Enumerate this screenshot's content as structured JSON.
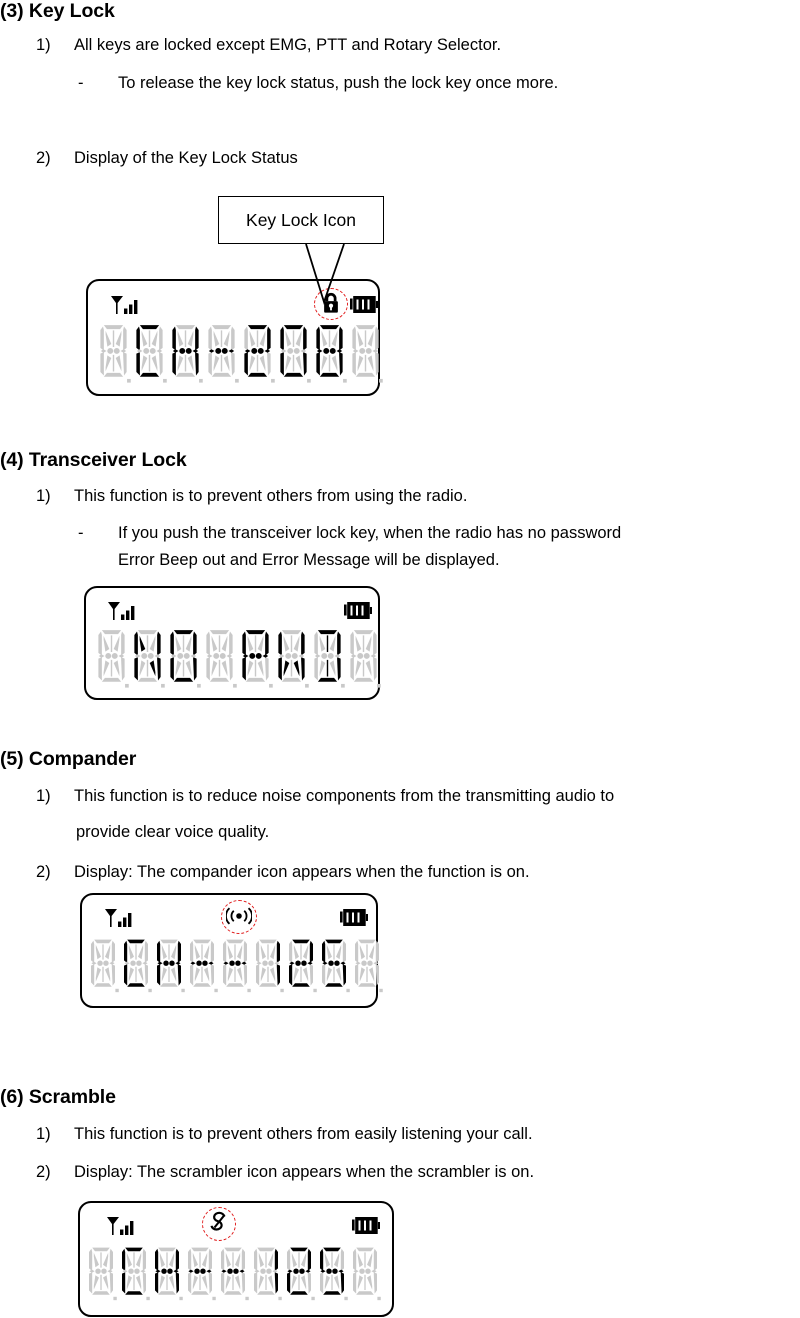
{
  "document": {
    "type": "radio-user-manual-page"
  },
  "sections": [
    {
      "id": "key-lock",
      "heading": "(3) Key Lock",
      "items": [
        {
          "marker": "1)",
          "text": "All keys are locked except EMG, PTT and Rotary Selector."
        },
        {
          "marker": "-",
          "text": "To release the key lock status, push the lock key once more."
        },
        {
          "marker": "2)",
          "text": "Display of the Key Lock Status"
        }
      ],
      "callout": {
        "label": "Key Lock Icon"
      },
      "lcd": {
        "characters": [
          "",
          "C",
          "H",
          "-",
          "2",
          "0",
          "8",
          ""
        ],
        "left_icon": "antenna-signal-icon",
        "right_icon": "battery-icon",
        "status_icon": "padlock-icon",
        "status_icon_highlighted": true
      }
    },
    {
      "id": "transceiver-lock",
      "heading": "(4) Transceiver Lock",
      "items": [
        {
          "marker": "1)",
          "text": "This function is to prevent others from using the radio."
        },
        {
          "marker": "-",
          "text": "If you push the transceiver lock key, when the radio has no password",
          "text2": "Error Beep out and Error Message will be displayed."
        }
      ],
      "lcd": {
        "characters": [
          "",
          "N",
          "O",
          "",
          "P",
          "W",
          "D",
          ""
        ],
        "left_icon": "antenna-signal-icon",
        "right_icon": "battery-icon",
        "status_icon": null,
        "status_icon_highlighted": false
      }
    },
    {
      "id": "compander",
      "heading": "(5) Compander",
      "items": [
        {
          "marker": "1)",
          "text": "This function is to reduce noise components from the transmitting audio to",
          "text2": "provide clear voice quality."
        },
        {
          "marker": "2)",
          "text": "Display: The compander icon appears when the function is on."
        }
      ],
      "lcd": {
        "characters": [
          "",
          "C",
          "H",
          "-",
          "-",
          "1",
          "2",
          "5",
          ""
        ],
        "left_icon": "antenna-signal-icon",
        "right_icon": "battery-icon",
        "status_icon": "compander-icon",
        "status_icon_highlighted": true
      }
    },
    {
      "id": "scramble",
      "heading": "(6) Scramble",
      "items": [
        {
          "marker": "1)",
          "text": "This function is to prevent others from easily listening your call."
        },
        {
          "marker": "2)",
          "text": "Display: The scrambler icon appears when the scrambler is on."
        }
      ],
      "lcd": {
        "characters": [
          "",
          "C",
          "H",
          "-",
          "-",
          "1",
          "2",
          "5",
          ""
        ],
        "left_icon": "antenna-signal-icon",
        "right_icon": "battery-icon",
        "status_icon": "scrambler-icon",
        "status_icon_highlighted": true
      }
    }
  ],
  "colors": {
    "text": "#000000",
    "highlight_ring": "#e01b1b",
    "segment_off": "#c9c9c9",
    "segment_on": "#000000",
    "background": "#ffffff"
  }
}
